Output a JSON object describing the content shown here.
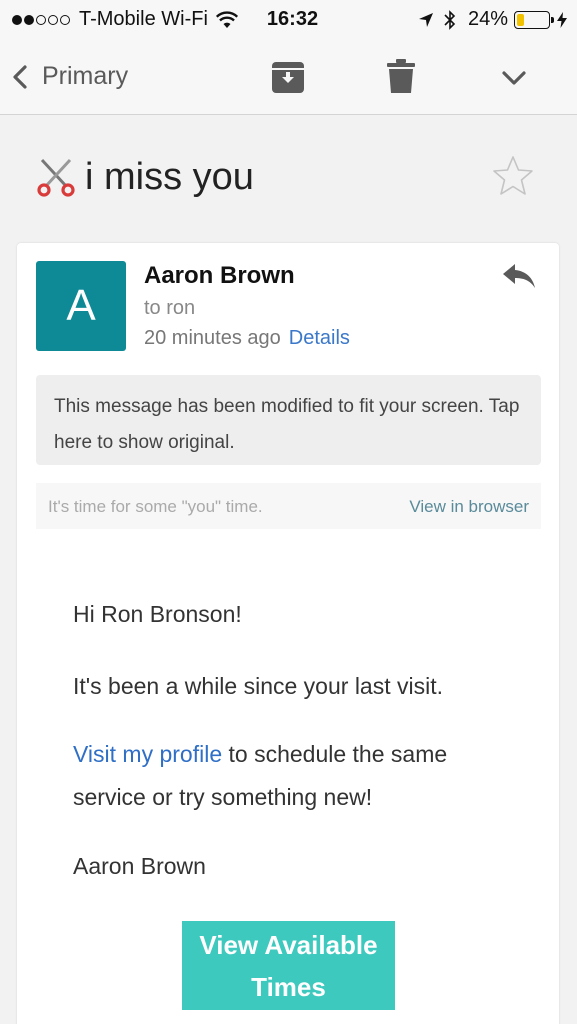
{
  "status_bar": {
    "carrier": "T-Mobile Wi-Fi",
    "time": "16:32",
    "battery_percent": "24%",
    "battery_level": 0.24,
    "battery_color": "#f2c200"
  },
  "nav": {
    "back_label": "Primary",
    "icons": [
      "chevron-left-icon",
      "archive-icon",
      "trash-icon",
      "chevron-down-icon"
    ]
  },
  "message": {
    "subject": "i miss you",
    "subject_icon": "scissors-icon",
    "sender_initial": "A",
    "sender_name": "Aaron Brown",
    "recipient": "to ron",
    "timestamp": "20 minutes ago",
    "details_label": "Details",
    "avatar_color": "#0e8a96",
    "modified_notice": "This message has been modified to fit your screen. Tap here to show original.",
    "preheader": "It's time for some \"you\" time.",
    "view_in_browser": "View in browser",
    "greeting": "Hi Ron Bronson!",
    "paragraph1": "It's been a while since your last visit.",
    "profile_link": "Visit my profile",
    "paragraph2_rest": " to schedule the same service or try something new!",
    "signature": "Aaron Brown",
    "cta_label": "View Available Times",
    "cta_color": "#3ec9be",
    "link_color": "#2f6fc6"
  }
}
